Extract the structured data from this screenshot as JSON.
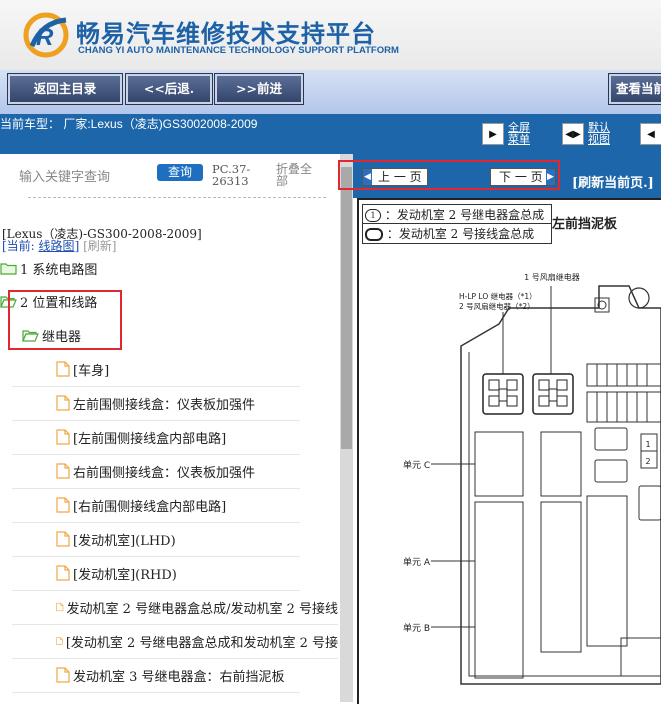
{
  "header": {
    "title_cn": "畅易汽车维修技术支持平台",
    "title_en": "CHANG YI AUTO MAINTENANCE TECHNOLOGY SUPPORT PLATFORM",
    "logo_icon": "chang-yi-logo",
    "brand_color": "#1d61a6"
  },
  "nav": {
    "main_menu": "返回主目录",
    "back": "<<后退.",
    "forward": ">>前进",
    "view_current": "查看当前"
  },
  "vehicle": {
    "label": "当前车型： 厂家:Lexus（凌志)GS3002008-2009",
    "fullscreen": [
      "全屏",
      "菜单"
    ],
    "default_view": [
      "默认",
      "视图"
    ]
  },
  "search": {
    "placeholder": "输入关键字查询",
    "query_button": "查询",
    "pc_code": "PC.37-26313",
    "collapse_all": "折叠全部"
  },
  "breadcrumb": {
    "model_path": "[Lexus（凌志)-GS300-2008-2009]",
    "current_prefix": "[当前: ",
    "current_value": "线路图",
    "current_suffix": "]",
    "refresh": "[刷新]"
  },
  "tree": {
    "folders": [
      {
        "label": "1 系统电路图"
      },
      {
        "label": "2 位置和线路"
      },
      {
        "label": "继电器"
      }
    ],
    "items": [
      "[车身]",
      "左前围侧接线盒：仪表板加强件",
      "[左前围侧接线盒内部电路]",
      "右前围侧接线盒：仪表板加强件",
      "[右前围侧接线盒内部电路]",
      "[发动机室](LHD)",
      "[发动机室](RHD)",
      "发动机室 2 号继电器盒总成/发动机室 2 号接线",
      "[发动机室 2 号继电器盒总成和发动机室 2 号接",
      "发动机室 3 号继电器盒：右前挡泥板"
    ]
  },
  "viewer": {
    "prev_page": "上 一 页",
    "next_page": "下 一 页",
    "refresh_page": "[刷新当前页.]",
    "legend": [
      {
        "symbol": "1",
        "text": "：发动机室 2 号继电器盒总成"
      },
      {
        "symbol": "",
        "text": "：发动机室 2 号接线盒总成"
      }
    ],
    "legend_side": "左前挡泥板",
    "diagram": {
      "relay_label_top": "1 号风扇继电器",
      "relay_label_left_1": "H-LP LO 继电器（*1）",
      "relay_label_left_2": "2 号风扇继电器（*2）",
      "unit_c": "单元 C",
      "unit_a": "单元 A",
      "unit_b": "单元 B"
    }
  },
  "colors": {
    "accent": "#1d66aa",
    "highlight": "#e0282e",
    "folder_green": "#4caa3c",
    "file_orange": "#f0a845"
  }
}
